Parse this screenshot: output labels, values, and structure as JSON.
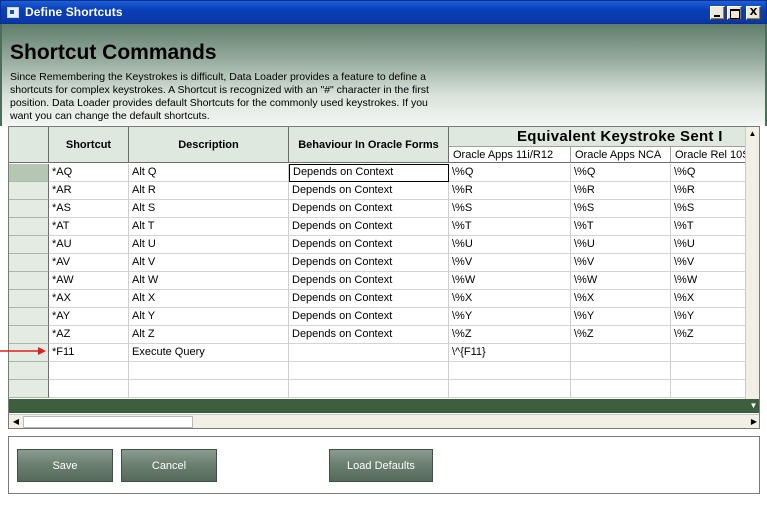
{
  "window": {
    "title": "Define Shortcuts",
    "controls": {
      "minimize": "_",
      "maximize": "□",
      "close": "X"
    }
  },
  "header": {
    "heading": "Shortcut Commands",
    "description": "Since Remembering the Keystrokes is difficult, Data Loader provides a feature to define a shortcuts for complex keystrokes. A Shortcut is recognized with an \"#\" character in the first position. Data Loader provides default Shortcuts for the commonly used keystrokes. If you want you can change the default shortcuts."
  },
  "grid": {
    "columns": {
      "shortcut": "Shortcut",
      "description": "Description",
      "behaviour": "Behaviour In Oracle Forms",
      "equivalent_title": "Equivalent Keystroke  Sent  I",
      "oracle_apps_11i": "Oracle Apps 11i/R12",
      "oracle_apps_nca": "Oracle Apps NCA",
      "oracle_rel": "Oracle Rel 10S"
    },
    "rows": [
      {
        "shortcut": "*AQ",
        "description": "Alt Q",
        "behaviour": "Depends on Context",
        "k11i": "\\%Q",
        "nca": "\\%Q",
        "rel": "\\%Q"
      },
      {
        "shortcut": "*AR",
        "description": "Alt R",
        "behaviour": "Depends on Context",
        "k11i": "\\%R",
        "nca": "\\%R",
        "rel": "\\%R"
      },
      {
        "shortcut": "*AS",
        "description": "Alt S",
        "behaviour": "Depends on Context",
        "k11i": "\\%S",
        "nca": "\\%S",
        "rel": "\\%S"
      },
      {
        "shortcut": "*AT",
        "description": "Alt T",
        "behaviour": "Depends on Context",
        "k11i": "\\%T",
        "nca": "\\%T",
        "rel": "\\%T"
      },
      {
        "shortcut": "*AU",
        "description": "Alt U",
        "behaviour": "Depends on Context",
        "k11i": "\\%U",
        "nca": "\\%U",
        "rel": "\\%U"
      },
      {
        "shortcut": "*AV",
        "description": "Alt V",
        "behaviour": "Depends on Context",
        "k11i": "\\%V",
        "nca": "\\%V",
        "rel": "\\%V"
      },
      {
        "shortcut": "*AW",
        "description": "Alt W",
        "behaviour": "Depends on Context",
        "k11i": "\\%W",
        "nca": "\\%W",
        "rel": "\\%W"
      },
      {
        "shortcut": "*AX",
        "description": "Alt X",
        "behaviour": "Depends on Context",
        "k11i": "\\%X",
        "nca": "\\%X",
        "rel": "\\%X"
      },
      {
        "shortcut": "*AY",
        "description": "Alt Y",
        "behaviour": "Depends on Context",
        "k11i": "\\%Y",
        "nca": "\\%Y",
        "rel": "\\%Y"
      },
      {
        "shortcut": "*AZ",
        "description": "Alt Z",
        "behaviour": "Depends on Context",
        "k11i": "\\%Z",
        "nca": "\\%Z",
        "rel": "\\%Z"
      },
      {
        "shortcut": "*F11",
        "description": "Execute Query",
        "behaviour": "",
        "k11i": "\\^{F11}",
        "nca": "",
        "rel": ""
      },
      {
        "shortcut": "",
        "description": "",
        "behaviour": "",
        "k11i": "",
        "nca": "",
        "rel": ""
      },
      {
        "shortcut": "",
        "description": "",
        "behaviour": "",
        "k11i": "",
        "nca": "",
        "rel": ""
      }
    ]
  },
  "buttons": {
    "save": "Save",
    "cancel": "Cancel",
    "load_defaults": "Load Defaults"
  },
  "colors": {
    "titlebar": "#0a3fb6",
    "header_band": "#96ab9e",
    "grid_footer": "#3c5f3e",
    "annotation_arrow": "#e0201c"
  }
}
